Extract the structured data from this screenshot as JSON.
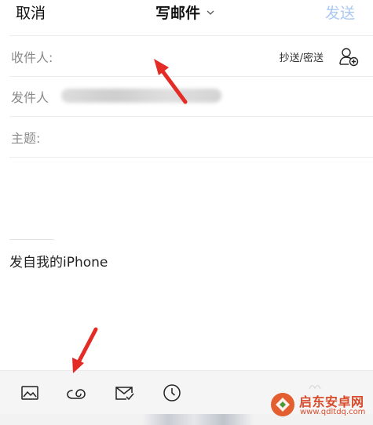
{
  "topbar": {
    "cancel_label": "取消",
    "title": "写邮件",
    "send_label": "发送"
  },
  "fields": {
    "to_label": "收件人:",
    "cc_bcc_label": "抄送/密送",
    "from_label": "发件人",
    "subject_label": "主题:"
  },
  "body": {
    "signature": "发自我的iPhone"
  },
  "toolbar": {
    "tools": [
      "image-icon",
      "attachment-icon",
      "mail-check-icon",
      "clock-icon"
    ]
  },
  "watermark": {
    "title": "启东安卓网",
    "url": "www.qdltdq.com"
  },
  "colors": {
    "send_disabled": "#a9c9f2",
    "label_gray": "#8a8a8a",
    "arrow_red": "#e42c27",
    "watermark_red": "#d94b2a"
  }
}
